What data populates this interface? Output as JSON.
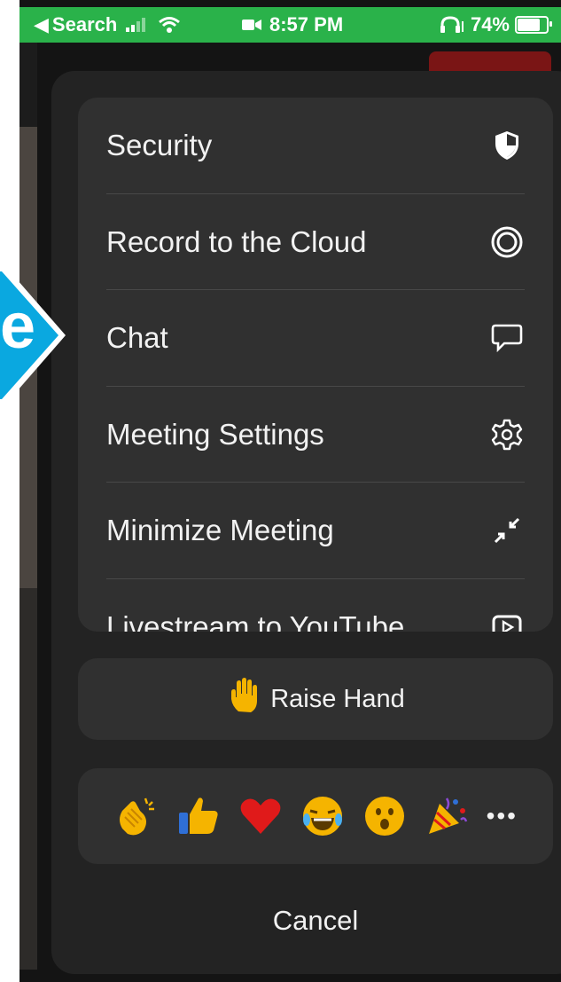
{
  "status_bar": {
    "back_label": "Search",
    "time": "8:57 PM",
    "battery": "74%",
    "icons": [
      "back-arrow-icon",
      "signal-icon",
      "wifi-icon",
      "video-icon",
      "headphones-icon",
      "battery-icon"
    ]
  },
  "callout": {
    "letter": "e",
    "color": "#0aa8e0"
  },
  "menu": {
    "items": [
      {
        "label": "Security",
        "icon": "shield-icon"
      },
      {
        "label": "Record to the Cloud",
        "icon": "record-icon"
      },
      {
        "label": "Chat",
        "icon": "chat-bubble-icon"
      },
      {
        "label": "Meeting Settings",
        "icon": "gear-icon"
      },
      {
        "label": "Minimize Meeting",
        "icon": "minimize-icon"
      },
      {
        "label": "Livestream to YouTube",
        "icon": "youtube-play-icon"
      }
    ]
  },
  "raise_hand": {
    "label": "Raise Hand",
    "icon": "raised-hand-icon"
  },
  "reactions": [
    "clapping-hands-icon",
    "thumbs-up-icon",
    "heart-icon",
    "laughing-face-icon",
    "surprised-face-icon",
    "party-popper-icon"
  ],
  "more_label": "•••",
  "cancel_label": "Cancel",
  "colors": {
    "sheet": "#232323",
    "card": "#303030",
    "status_bar": "#2ab24a",
    "accent": "#0aa8e0"
  }
}
